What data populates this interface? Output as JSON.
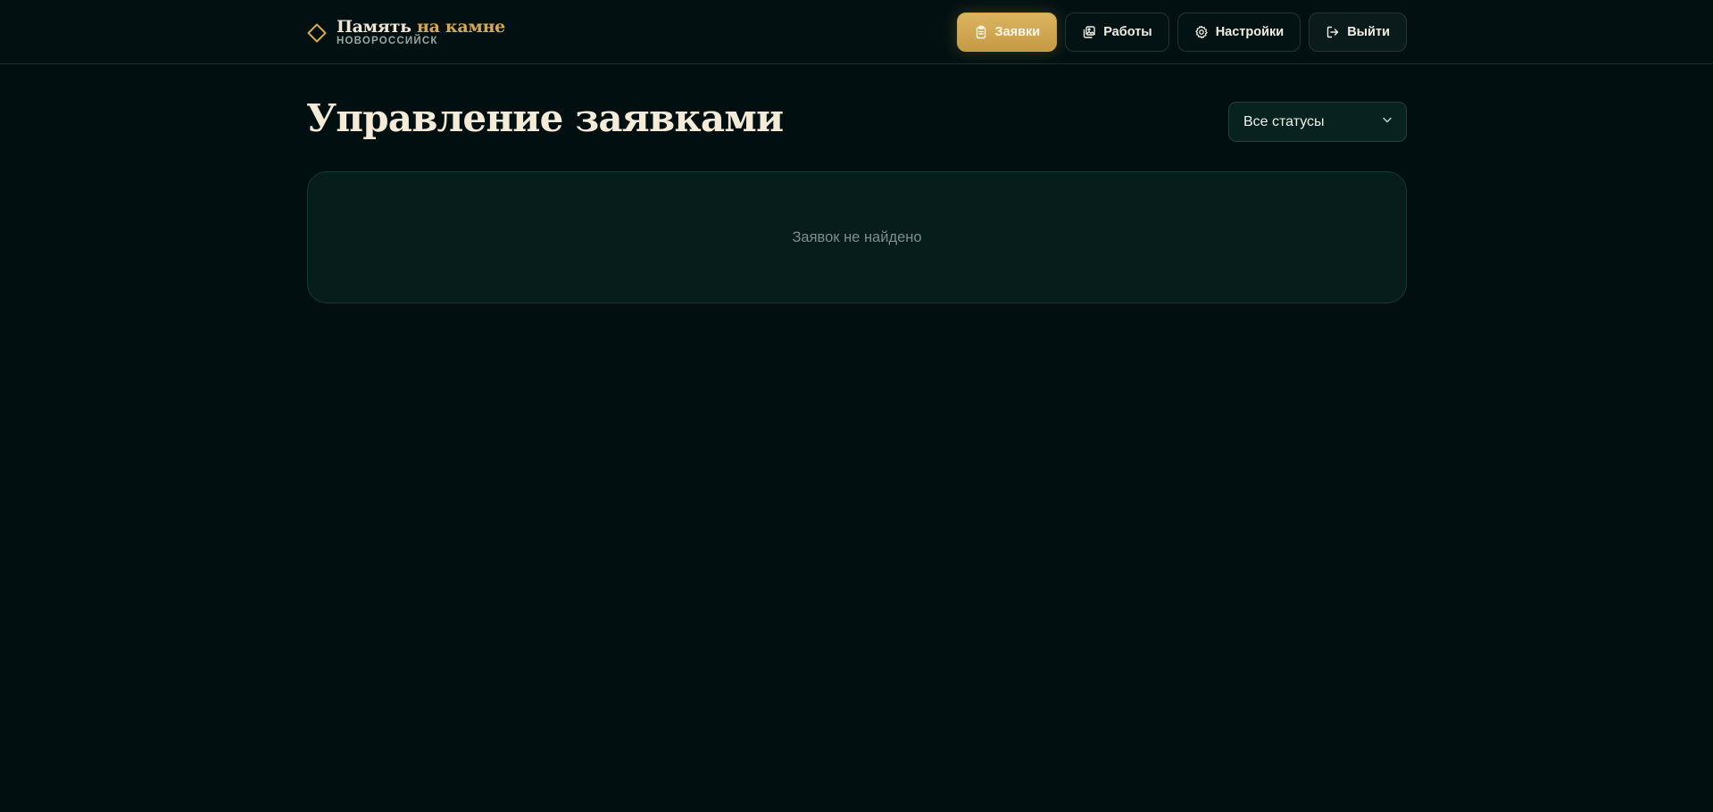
{
  "brand": {
    "title_main": "Память",
    "title_accent": "на камне",
    "subtitle": "НОВОРОССИЙСК",
    "logo_icon": "diamond-icon",
    "accent_color": "#d4a84c"
  },
  "nav": {
    "items": [
      {
        "label": "Заявки",
        "icon": "clipboard-icon",
        "active": true
      },
      {
        "label": "Работы",
        "icon": "images-icon",
        "active": false
      },
      {
        "label": "Настройки",
        "icon": "gear-icon",
        "active": false
      },
      {
        "label": "Выйти",
        "icon": "logout-icon",
        "active": false
      }
    ]
  },
  "main": {
    "title": "Управление заявками",
    "filter": {
      "selected": "Все статусы",
      "icon": "chevron-down-icon"
    },
    "empty_message": "Заявок не найдено"
  }
}
